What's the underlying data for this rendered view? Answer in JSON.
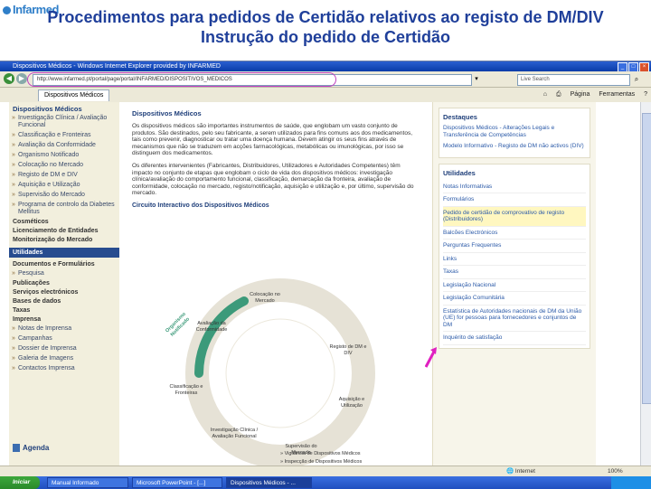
{
  "slide": {
    "logo": "Infarmed",
    "title_line1": "Procedimentos para pedidos de Certidão relativos ao registo de DM/DIV",
    "title_line2": "Instrução do pedido de Certidão"
  },
  "browser": {
    "window_title": "Dispositivos Médicos - Windows Internet Explorer provided by INFARMED",
    "url": "http://www.infarmed.pt/portal/page/portal/INFARMED/DISPOSITIVOS_MEDICOS",
    "search_placeholder": "Live Search",
    "tab_label": "Dispositivos Médicos",
    "tools": [
      "Página",
      "Ferramentas"
    ]
  },
  "left_nav": {
    "section_title": "Dispositivos Médicos",
    "items": [
      "Investigação Clínica / Avaliação Funcional",
      "Classificação e Fronteiras",
      "Avaliação da Conformidade",
      "Organismo Notificado",
      "Colocação no Mercado",
      "Registo de DM e DIV",
      "Aquisição e Utilização",
      "Supervisão do Mercado",
      "Programa de controlo da Diabetes Mellitus"
    ],
    "bold_items": [
      "Cosméticos",
      "Licenciamento de Entidades",
      "Monitorização do Mercado"
    ],
    "active": "Utilidades",
    "bold_items2": [
      "Documentos e Formulários"
    ],
    "sub1": [
      "Pesquisa"
    ],
    "bold_items3": [
      "Publicações",
      "Serviços electrónicos",
      "Bases de dados",
      "Taxas",
      "Imprensa"
    ],
    "sub2": [
      "Notas de Imprensa",
      "Campanhas",
      "Dossier de Imprensa",
      "Galeria de Imagens",
      "Contactos Imprensa"
    ],
    "agenda": "Agenda"
  },
  "main": {
    "heading": "Dispositivos Médicos",
    "para1": "Os dispositivos médicos são importantes instrumentos de saúde, que englobam um vasto conjunto de produtos. São destinados, pelo seu fabricante, a serem utilizados para fins comuns aos dos medicamentos, tais como prevenir, diagnosticar ou tratar uma doença humana. Devem atingir os seus fins através de mecanismos que não se traduzem em acções farmacológicas, metabólicas ou imunológicas, por isso se distinguem dos medicamentos.",
    "para2": "Os diferentes intervenientes (Fabricantes, Distribuidores, Utilizadores e Autoridades Competentes) têm impacto no conjunto de etapas que englobam o ciclo de vida dos dispositivos médicos: investigação clínica/avaliação do comportamento funcional, classificação, demarcação da fronteira, avaliação de conformidade, colocação no mercado, registo/notificação, aquisição e utilização e, por último, supervisão do mercado.",
    "circuit_title": "Circuito Interactivo dos Dispositivos Médicos",
    "cycle_nodes": [
      "Colocação no Mercado",
      "Avaliação da Conformidade",
      "Registo de DM e DIV",
      "Classificação e Fronteiras",
      "Aquisição e Utilização",
      "Investigação Clínica / Avaliação Funcional",
      "Supervisão do Mercado",
      "Organismo Notificado"
    ],
    "cycle_links": [
      "Vigilância de Dispositivos Médicos",
      "Inspecção de Dispositivos Médicos"
    ]
  },
  "right": {
    "highlights_title": "Destaques",
    "highlights": [
      "Dispositivos Médicos - Alterações Legais e Transferência de Competências",
      "Modelo Informativo - Registo de DM não activos (DIV)"
    ],
    "utilities_title": "Utilidades",
    "utilities": [
      "Notas Informativas",
      "Formulários",
      "Pedido de certidão de comprovativo de registo (Distribuidores)",
      "Balcões Electrónicos",
      "Perguntas Frequentes",
      "Links",
      "Taxas",
      "Legislação Nacional",
      "Legislação Comunitária",
      "Estatística de Autoridades nacionais de DM da União (UE) for pessoas para fornecedores e conjuntos de DM",
      "Inquérito de satisfação"
    ]
  },
  "status": {
    "zone": "Internet",
    "zoom": "100%"
  },
  "taskbar": {
    "start": "Iniciar",
    "tasks": [
      "Manual Informado",
      "Microsoft PowerPoint - [...]",
      "Dispositivos Médicos - ..."
    ]
  },
  "colors": {
    "title_blue": "#1f3f9a",
    "nav_active": "#274c8f",
    "arrow_magenta": "#e020c0"
  }
}
